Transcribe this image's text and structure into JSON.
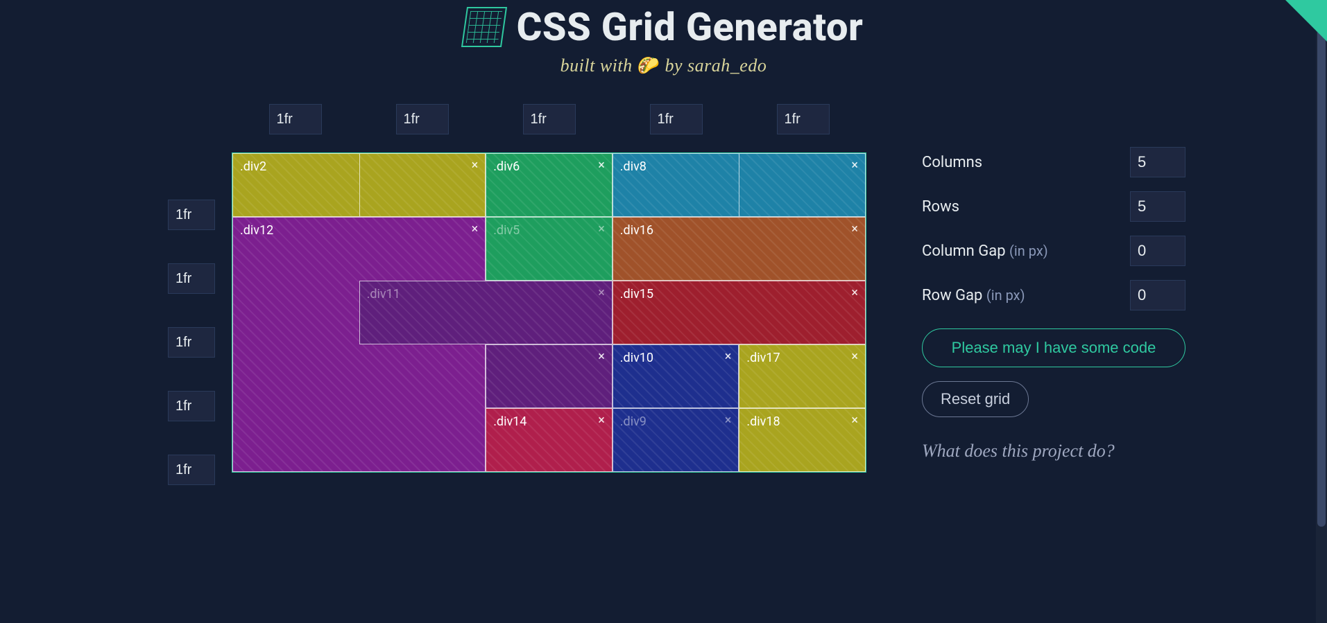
{
  "header": {
    "title": "CSS Grid Generator",
    "subtitle_prefix": "built with ",
    "subtitle_taco": "🌮",
    "subtitle_suffix": " by sarah_edo"
  },
  "col_units": [
    "1fr",
    "1fr",
    "1fr",
    "1fr",
    "1fr"
  ],
  "row_units": [
    "1fr",
    "1fr",
    "1fr",
    "1fr",
    "1fr"
  ],
  "blocks": [
    {
      "label": ".div2",
      "col": "1 / 3",
      "row": "1 / 2",
      "color": "#a9a41f",
      "z": 2,
      "muted": false
    },
    {
      "label": "",
      "col": "2 / 3",
      "row": "1 / 2",
      "color": "#a9a41f",
      "z": 2,
      "muted": false
    },
    {
      "label": ".div6",
      "col": "3 / 4",
      "row": "1 / 2",
      "color": "#1e9e5e",
      "z": 2,
      "muted": false
    },
    {
      "label": ".div8",
      "col": "4 / 6",
      "row": "1 / 2",
      "color": "#1e82a7",
      "z": 2,
      "muted": false
    },
    {
      "label": "",
      "col": "5 / 6",
      "row": "1 / 2",
      "color": "#1e82a7",
      "z": 2,
      "muted": false
    },
    {
      "label": ".div12",
      "col": "1 / 3",
      "row": "2 / 6",
      "color": "#7c1f8f",
      "z": 1,
      "muted": false
    },
    {
      "label": ".div5",
      "col": "3 / 4",
      "row": "2 / 3",
      "color": "#1e9e5e",
      "z": 2,
      "muted": true
    },
    {
      "label": ".div16",
      "col": "4 / 6",
      "row": "2 / 3",
      "color": "#a0522a",
      "z": 2,
      "muted": false
    },
    {
      "label": ".div11",
      "col": "2 / 4",
      "row": "3 / 4",
      "color": "#5f1f7c",
      "z": 2,
      "muted": true
    },
    {
      "label": ".div15",
      "col": "4 / 6",
      "row": "3 / 4",
      "color": "#9e1f2e",
      "z": 2,
      "muted": false
    },
    {
      "label": "",
      "col": "3 / 4",
      "row": "4 / 5",
      "color": "#5f1f7c",
      "z": 2,
      "muted": false
    },
    {
      "label": ".div10",
      "col": "4 / 5",
      "row": "4 / 5",
      "color": "#1e2f8e",
      "z": 2,
      "muted": false
    },
    {
      "label": ".div17",
      "col": "5 / 6",
      "row": "4 / 5",
      "color": "#a9a41f",
      "z": 2,
      "muted": false
    },
    {
      "label": ".div14",
      "col": "3 / 4",
      "row": "5 / 6",
      "color": "#b01f4c",
      "z": 2,
      "muted": false
    },
    {
      "label": ".div9",
      "col": "4 / 5",
      "row": "5 / 6",
      "color": "#1e2f8e",
      "z": 2,
      "muted": true
    },
    {
      "label": ".div18",
      "col": "5 / 6",
      "row": "5 / 6",
      "color": "#a9a41f",
      "z": 2,
      "muted": false
    }
  ],
  "controls": {
    "columns_label": "Columns",
    "columns_value": "5",
    "rows_label": "Rows",
    "rows_value": "5",
    "colgap_label": "Column Gap ",
    "rowgap_label": "Row Gap ",
    "px_hint": "(in px)",
    "colgap_value": "0",
    "rowgap_value": "0",
    "code_button": "Please may I have some code",
    "reset_button": "Reset grid",
    "project_link": "What does this project do?"
  }
}
